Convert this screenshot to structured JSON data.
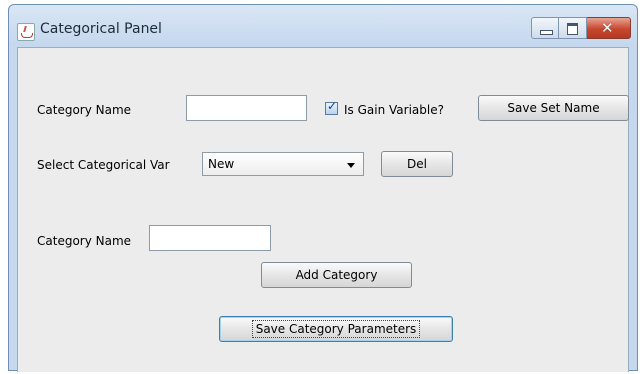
{
  "window": {
    "title": "Categorical Panel",
    "close_glyph": "✕"
  },
  "set_row": {
    "label": "Category Name",
    "input_value": "",
    "gain_label": "Is Gain Variable?",
    "gain_checked": true,
    "save_label": "Save Set Name"
  },
  "select_row": {
    "label": "Select Categorical Var",
    "selected": "New",
    "del_label": "Del"
  },
  "category_row": {
    "label": "Category Name",
    "input_value": "",
    "add_label": "Add Category"
  },
  "footer": {
    "save_params_label": "Save Category Parameters"
  },
  "colors": {
    "titlebar": "#c6d8ee",
    "client_bg": "#ececec",
    "close_button": "#c6472f"
  },
  "icons": [
    "java-app-icon",
    "minimize-icon",
    "maximize-icon",
    "close-icon",
    "check-icon",
    "dropdown-arrow-icon"
  ]
}
